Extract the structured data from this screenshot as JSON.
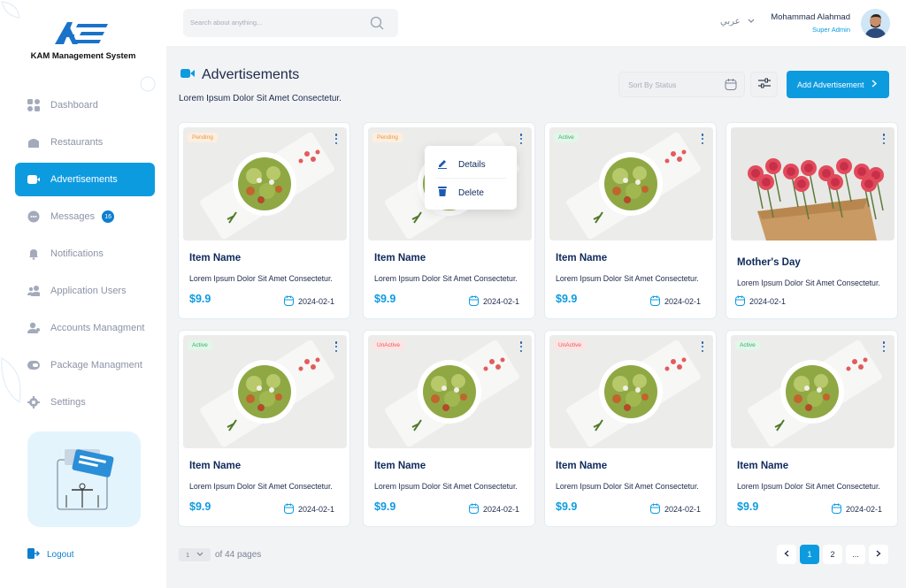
{
  "brand": {
    "name": "KAM Management System"
  },
  "sidebar": {
    "items": [
      {
        "label": "Dashboard",
        "icon": "dashboard-icon"
      },
      {
        "label": "Restaurants",
        "icon": "restaurant-icon"
      },
      {
        "label": "Advertisements",
        "icon": "video-camera-icon",
        "active": true
      },
      {
        "label": "Messages",
        "icon": "chat-icon",
        "badge": "16"
      },
      {
        "label": "Notifications",
        "icon": "bell-icon"
      },
      {
        "label": "Application Users",
        "icon": "users-icon"
      },
      {
        "label": "Accounts Managment",
        "icon": "user-accounts-icon"
      },
      {
        "label": "Package Managment",
        "icon": "package-icon"
      },
      {
        "label": "Settings",
        "icon": "gear-icon"
      }
    ],
    "logout": "Logout"
  },
  "header": {
    "search_placeholder": "Search about anything...",
    "language": "عربي",
    "user_name": "Mohammad Alahmad",
    "user_role": "Super Admin"
  },
  "page": {
    "title": "Advertisements",
    "subtitle": "Lorem Ipsum Dolor Sit Amet Consectetur.",
    "sort_placeholder": "Sort By Status",
    "add_button": "Add Advertisement"
  },
  "cards": [
    {
      "status": "Pending",
      "status_type": "pending",
      "name": "Item Name",
      "desc": "Lorem Ipsum Dolor Sit Amet Consectetur.",
      "price": "$9.9",
      "date": "2024-02-1"
    },
    {
      "status": "Pending",
      "status_type": "pending",
      "name": "Item Name",
      "desc": "Lorem Ipsum Dolor Sit Amet Consectetur.",
      "price": "$9.9",
      "date": "2024-02-1"
    },
    {
      "status": "Active",
      "status_type": "active",
      "name": "Item Name",
      "desc": "Lorem Ipsum Dolor Sit Amet Consectetur.",
      "price": "$9.9",
      "date": "2024-02-1"
    },
    {
      "status": "",
      "status_type": "none",
      "name": "Mother's Day",
      "desc": "Lorem Ipsum Dolor Sit Amet Consectetur.",
      "price": "",
      "date": "2024-02-1"
    },
    {
      "status": "Active",
      "status_type": "active",
      "name": "Item Name",
      "desc": "Lorem Ipsum Dolor Sit Amet Consectetur.",
      "price": "$9.9",
      "date": "2024-02-1"
    },
    {
      "status": "UnActive",
      "status_type": "unactive",
      "name": "Item Name",
      "desc": "Lorem Ipsum Dolor Sit Amet Consectetur.",
      "price": "$9.9",
      "date": "2024-02-1"
    },
    {
      "status": "UnActive",
      "status_type": "unactive",
      "name": "Item Name",
      "desc": "Lorem Ipsum Dolor Sit Amet Consectetur.",
      "price": "$9.9",
      "date": "2024-02-1"
    },
    {
      "status": "Active",
      "status_type": "active",
      "name": "Item Name",
      "desc": "Lorem Ipsum Dolor Sit Amet Consectetur.",
      "price": "$9.9",
      "date": "2024-02-1"
    }
  ],
  "menu": {
    "details": "Details",
    "delete": "Delete"
  },
  "pagination": {
    "current_select": "1",
    "of_text": "of 44 pages",
    "pages": [
      "1",
      "2",
      "..."
    ],
    "active_page": "1"
  },
  "colors": {
    "accent": "#0d9be0",
    "title": "#0f2a5c",
    "pending": "#e6994d",
    "active": "#3cae6b",
    "unactive": "#e15b5b"
  }
}
